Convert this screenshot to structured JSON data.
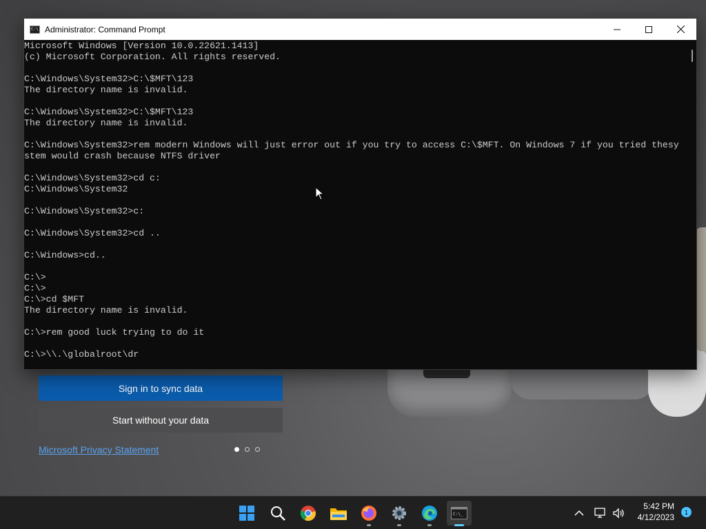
{
  "background_app": {
    "sign_in_button": "Sign in to sync data",
    "start_without_button": "Start without your data",
    "privacy_link": "Microsoft Privacy Statement",
    "page_dots": [
      true,
      false,
      false
    ]
  },
  "window": {
    "title": "Administrator: Command Prompt",
    "terminal_lines": [
      "Microsoft Windows [Version 10.0.22621.1413]",
      "(c) Microsoft Corporation. All rights reserved.",
      "",
      "C:\\Windows\\System32>C:\\$MFT\\123",
      "The directory name is invalid.",
      "",
      "C:\\Windows\\System32>C:\\$MFT\\123",
      "The directory name is invalid.",
      "",
      "C:\\Windows\\System32>rem modern Windows will just error out if you try to access C:\\$MFT. On Windows 7 if you tried thesy",
      "stem would crash because NTFS driver",
      "",
      "C:\\Windows\\System32>cd c:",
      "C:\\Windows\\System32",
      "",
      "C:\\Windows\\System32>c:",
      "",
      "C:\\Windows\\System32>cd ..",
      "",
      "C:\\Windows>cd..",
      "",
      "C:\\>",
      "C:\\>",
      "C:\\>cd $MFT",
      "The directory name is invalid.",
      "",
      "C:\\>rem good luck trying to do it",
      "",
      "C:\\>\\\\.\\globalroot\\dr"
    ]
  },
  "taskbar": {
    "apps": [
      {
        "name": "start-icon",
        "running": false
      },
      {
        "name": "search-icon",
        "running": false
      },
      {
        "name": "chrome-icon",
        "running": false
      },
      {
        "name": "file-explorer-icon",
        "running": false
      },
      {
        "name": "firefox-icon",
        "running": true
      },
      {
        "name": "settings-icon",
        "running": true
      },
      {
        "name": "edge-icon",
        "running": true
      },
      {
        "name": "terminal-icon",
        "running": true,
        "active": true
      }
    ],
    "clock_time": "5:42 PM",
    "clock_date": "4/12/2023",
    "notification_count": "1"
  },
  "colors": {
    "terminal_bg": "#0c0c0c",
    "terminal_fg": "#cccccc",
    "accent": "#0b5cad",
    "taskbar_bg": "#202020"
  }
}
